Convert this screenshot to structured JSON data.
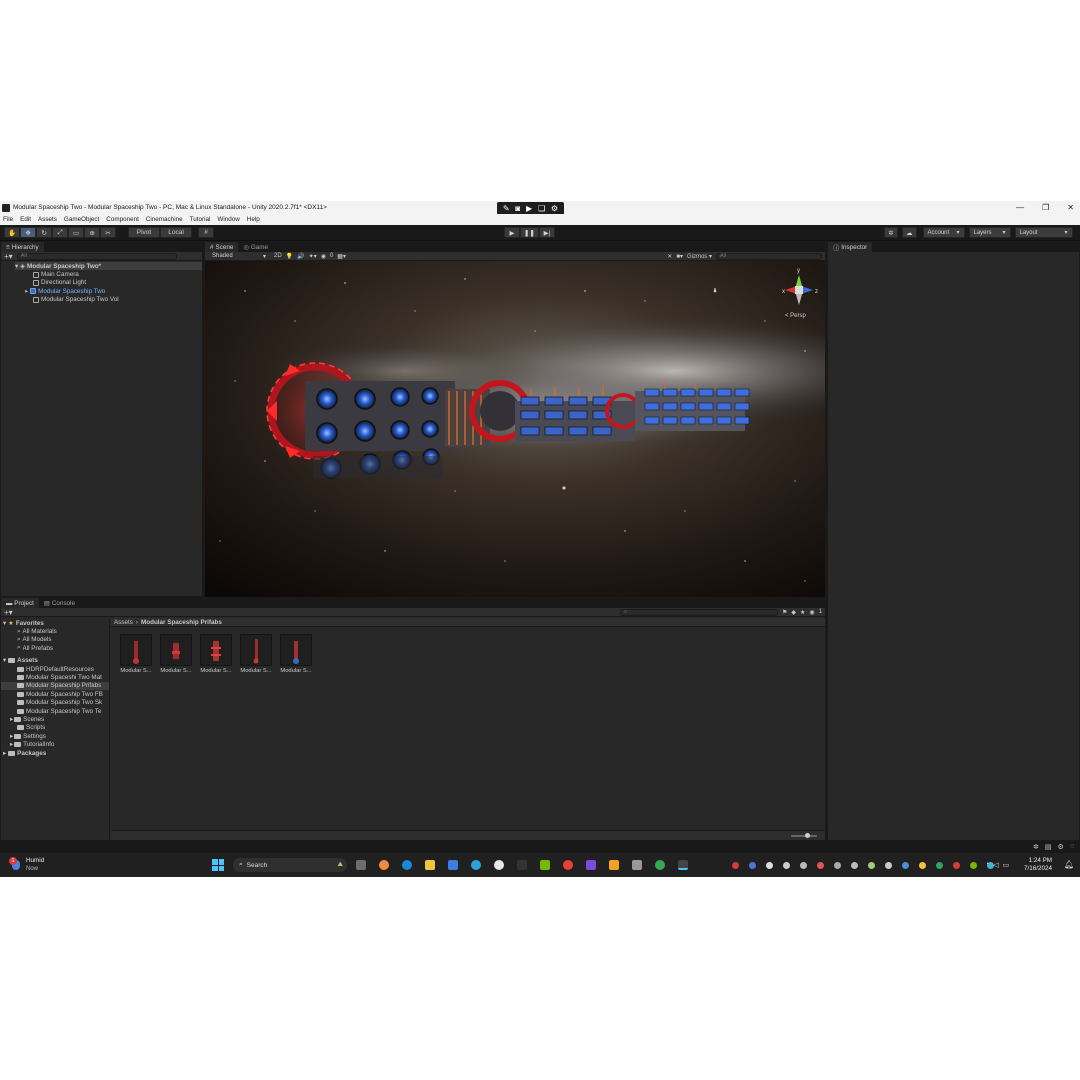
{
  "window": {
    "title": "Modular Spaceship Two - Modular Spaceship Two - PC, Mac & Linux Standalone - Unity 2020.2.7f1* <DX11>",
    "controls": [
      "—",
      "❐",
      "✕"
    ]
  },
  "menu": [
    "File",
    "Edit",
    "Assets",
    "GameObject",
    "Component",
    "Cinemachine",
    "Tutorial",
    "Window",
    "Help"
  ],
  "toolbar": {
    "pivot": "Pivot",
    "local": "Local",
    "account": "Account",
    "layers": "Layers",
    "layout": "Layout"
  },
  "hierarchy": {
    "tab": "Hierarchy",
    "search_placeholder": "All",
    "root": "Modular Spaceship Two*",
    "items": [
      "Main Camera",
      "Directional Light",
      "Modular Spaceship Two",
      "Modular Spaceship Two Vol"
    ]
  },
  "scene": {
    "tabs": [
      "Scene",
      "Game"
    ],
    "shading": "Shaded",
    "mode_2d": "2D",
    "hidden_count": "0",
    "gizmos": "Gizmos",
    "search_placeholder": "All",
    "persp": "< Persp",
    "axes": {
      "x": "x",
      "y": "y",
      "z": "z"
    }
  },
  "inspector": {
    "tab": "Inspector"
  },
  "project": {
    "tabs": [
      "Project",
      "Console"
    ],
    "favorites_label": "Favorites",
    "favorites": [
      "All Materials",
      "All Models",
      "All Prefabs"
    ],
    "assets_label": "Assets",
    "folders": [
      "HDRPDefaultResources",
      "Modular Spaceshi Two Mat",
      "Modular Spaceship Prifabs",
      "Modular Spaceship Two FB",
      "Modular Spaceship Two Sk",
      "Modular Spaceship Two Te",
      "Scenes",
      "Scripts",
      "Settings",
      "TutorialInfo"
    ],
    "packages_label": "Packages",
    "breadcrumb_root": "Assets",
    "breadcrumb_current": "Modular Spaceship Prifabs",
    "asset_labels": [
      "Modular S...",
      "Modular S...",
      "Modular S...",
      "Modular S...",
      "Modular S..."
    ],
    "hidden_count": "1"
  },
  "taskbar": {
    "weather_title": "Humid",
    "weather_sub": "Now",
    "badge": "1",
    "search": "Search",
    "time": "1:24 PM",
    "date": "7/16/2024"
  },
  "colors": {
    "accent_blue": "#46607c",
    "panel": "#282828",
    "background": "#191919",
    "ship_red": "#d8222b",
    "ship_blue": "#3c6fd8"
  }
}
